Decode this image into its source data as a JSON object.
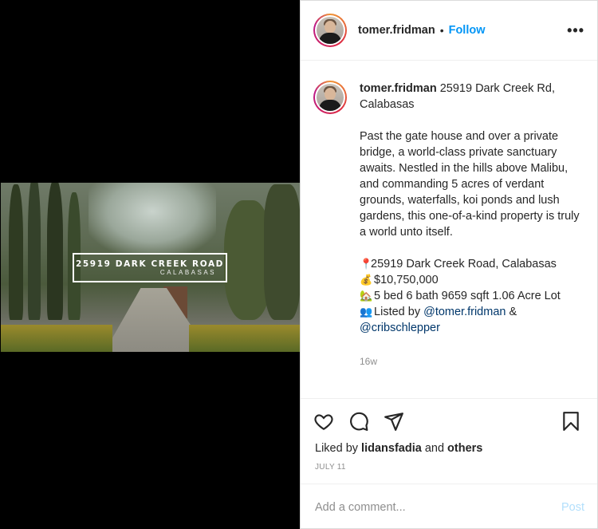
{
  "video": {
    "title_main": "25919 DARK CREEK ROAD",
    "title_sub": "CALABASAS"
  },
  "header": {
    "username": "tomer.fridman",
    "separator": "•",
    "follow_label": "Follow",
    "more_label": "•••"
  },
  "caption": {
    "username": "tomer.fridman",
    "headline": "25919 Dark Creek Rd, Calabasas",
    "description": "Past the gate house and over a private bridge, a world-class private sanctuary awaits. Nestled in the hills above Malibu, and commanding 5 acres of verdant grounds, waterfalls, koi ponds and lush gardens, this one-of-a-kind property is truly a world unto itself.",
    "address_line": "25919 Dark Creek Road, Calabasas",
    "price_line": " $10,750,000",
    "details_line": " 5 bed 6 bath 9659 sqft 1.06 Acre Lot",
    "listed_prefix": " Listed by ",
    "listed_mention1": "@tomer.fridman",
    "listed_and": " &",
    "listed_mention2": "@cribschlepper",
    "age": "16w"
  },
  "actions": {
    "liked_by_prefix": "Liked by ",
    "liked_by_user": "lidansfadia",
    "liked_by_and": " and ",
    "liked_by_others": "others",
    "date": "JULY 11"
  },
  "comment": {
    "placeholder": "Add a comment...",
    "post_label": "Post"
  },
  "colors": {
    "accent": "#0095f6",
    "mention": "#00376b",
    "muted": "#8e8e8e",
    "post_disabled": "#b2dffc"
  },
  "icons": {
    "pin": "round-pushpin-icon",
    "money": "money-bag-icon",
    "house": "house-with-garden-icon",
    "people": "busts-in-silhouette-icon"
  }
}
